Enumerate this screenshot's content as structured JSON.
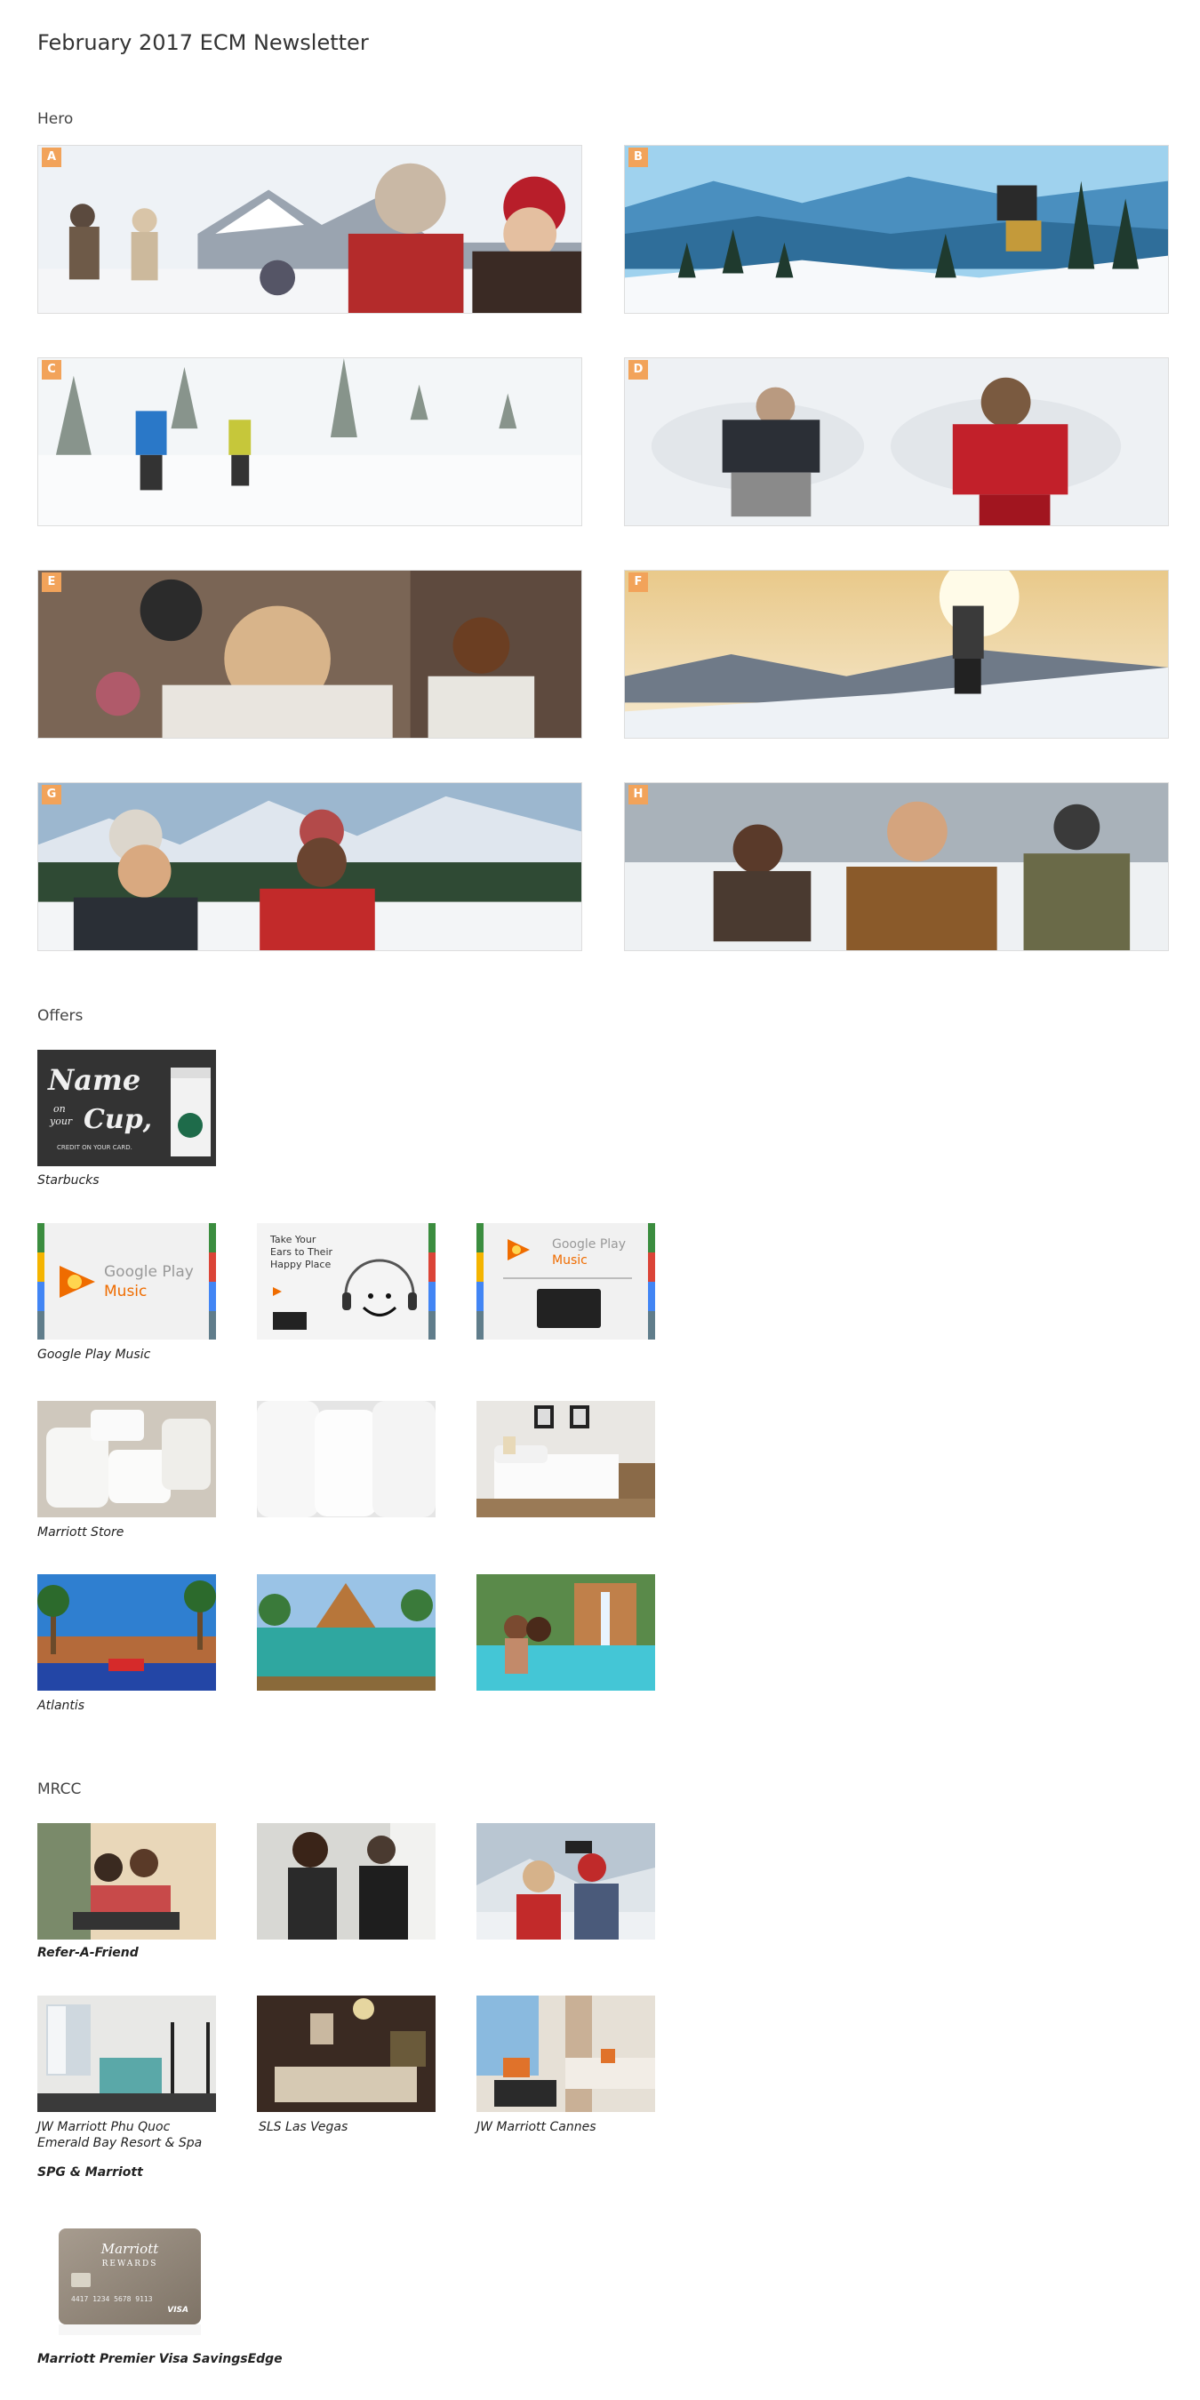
{
  "page": {
    "title": "February 2017 ECM Newsletter"
  },
  "sections": {
    "hero": "Hero",
    "offers": "Offers",
    "mrcc": "MRCC"
  },
  "hero_tags": [
    "A",
    "B",
    "C",
    "D",
    "E",
    "F",
    "G",
    "H"
  ],
  "offers_captions": {
    "starbucks": "Starbucks",
    "google_play": "Google Play Music",
    "marriott_store": "Marriott Store",
    "atlantis": "Atlantis"
  },
  "starbucks_text": {
    "line1": "Name",
    "line2": "on",
    "line3": "your",
    "line4": "Cup,",
    "footer": "CREDIT ON YOUR CARD."
  },
  "gpm": {
    "brand": "Google Play",
    "product": "Music",
    "tag_line1": "Take Your",
    "tag_line2": "Ears to Their",
    "tag_line3": "Happy Place"
  },
  "mrcc_captions": {
    "refer": "Refer-A-Friend",
    "phu_quoc_line1": "JW Marriott Phu Quoc",
    "phu_quoc_line2": "Emerald Bay Resort & Spa",
    "sls": "SLS Las Vegas",
    "cannes": "JW Marriott Cannes",
    "spg": "SPG & Marriott",
    "card": "Marriott Premier Visa SavingsEdge"
  },
  "card_text": {
    "brand": "Marriott",
    "rewards": "REWARDS",
    "number": "4417 1234 5678 9113",
    "network": "VISA"
  },
  "colors": {
    "tag": "#f2a35a",
    "gpm_orange": "#ef6c00"
  }
}
